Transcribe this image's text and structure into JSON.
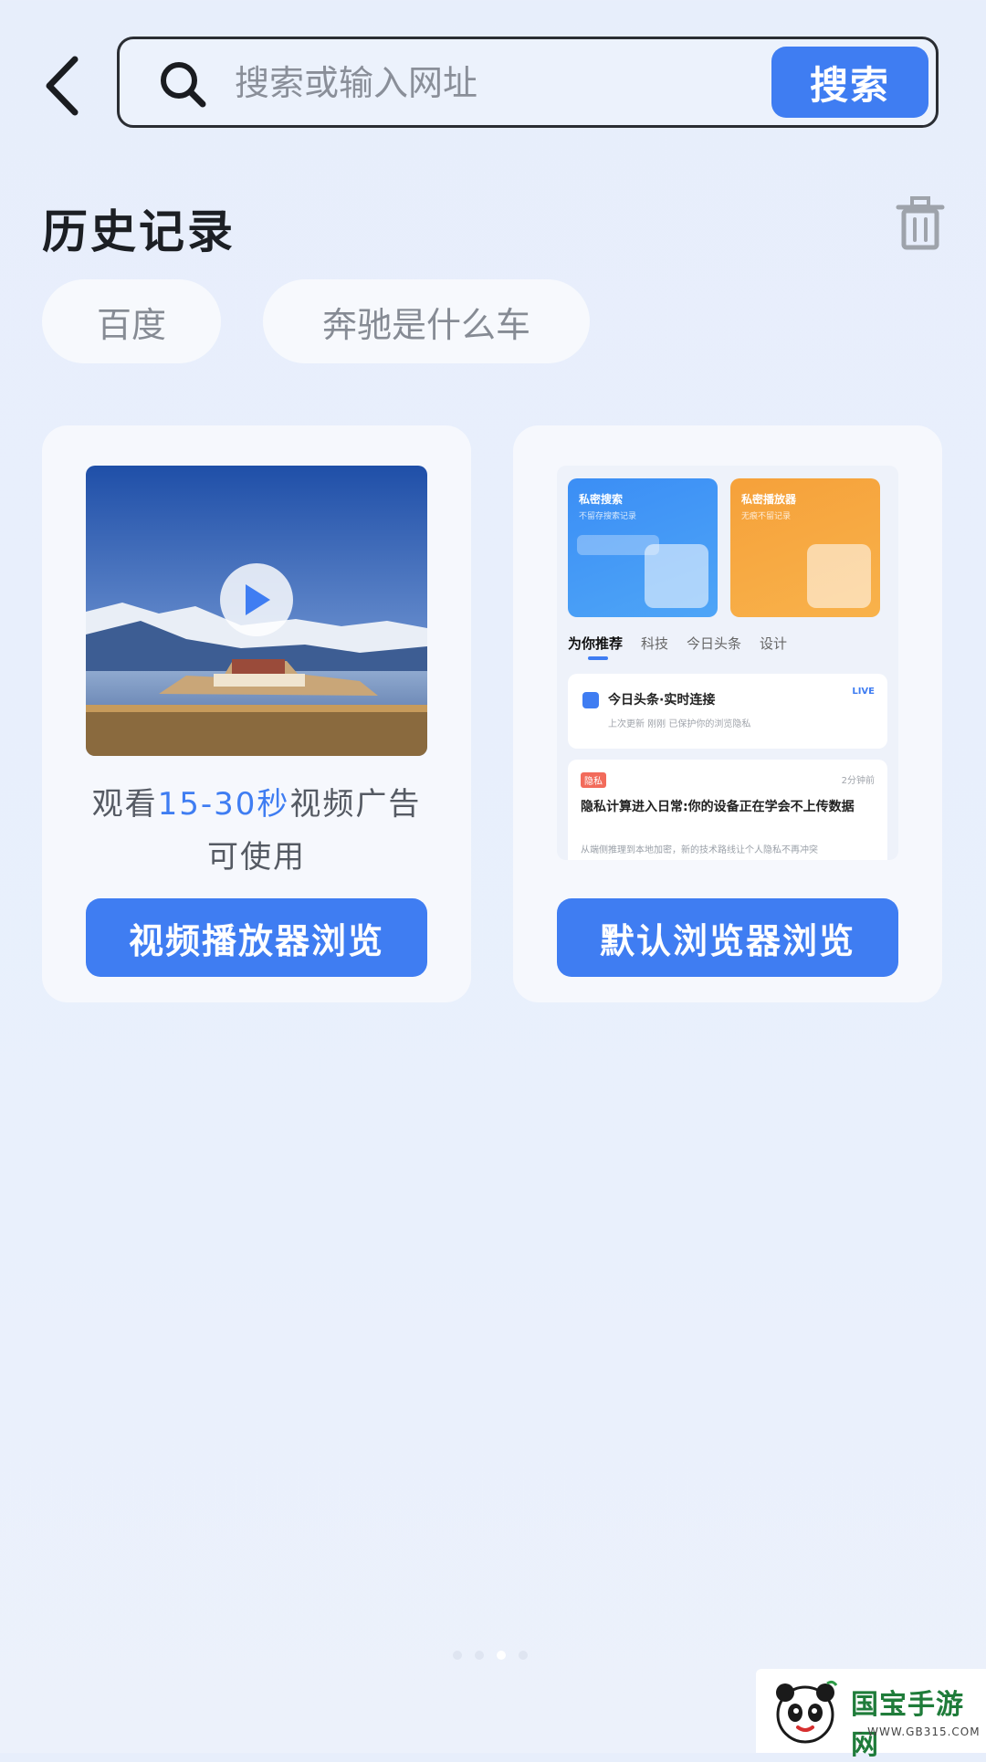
{
  "header": {
    "search_placeholder": "搜索或输入网址",
    "search_button_label": "搜索"
  },
  "history": {
    "title": "历史记录",
    "items": [
      {
        "label": "百度"
      },
      {
        "label": "奔驰是什么车"
      }
    ]
  },
  "cards": {
    "video": {
      "ad_prefix": "观看",
      "ad_highlight": "15-30秒",
      "ad_suffix": "视频广告",
      "ad_line2": "可使用",
      "button_label": "视频播放器浏览"
    },
    "browser": {
      "button_label": "默认浏览器浏览",
      "preview": {
        "promo_blue_title": "私密搜索",
        "promo_blue_sub": "不留存搜索记录",
        "promo_orange_title": "私密播放器",
        "promo_orange_sub": "无痕不留记录",
        "tabs": [
          "为你推荐",
          "科技",
          "今日头条",
          "设计"
        ],
        "news_1_title": "今日头条·实时连接",
        "news_1_tag": "LIVE",
        "news_1_meta": "上次更新 刚刚  已保护你的浏览隐私",
        "news_2_tag": "隐私",
        "news_2_time": "2分钟前",
        "news_2_title": "隐私计算进入日常:你的设备正在学会不上传数据",
        "news_2_desc": "从端侧推理到本地加密，新的技术路线让个人隐私不再冲突"
      }
    }
  },
  "watermark": {
    "title": "国宝手游网",
    "url": "- WWW.GB315.COM -"
  },
  "pager": {
    "count": 4,
    "active_index": 2
  },
  "colors": {
    "accent": "#3f7df2",
    "background": "#e8effc"
  },
  "icons": {
    "back": "back-arrow-icon",
    "search": "search-icon",
    "delete": "trash-icon",
    "play": "play-icon"
  }
}
